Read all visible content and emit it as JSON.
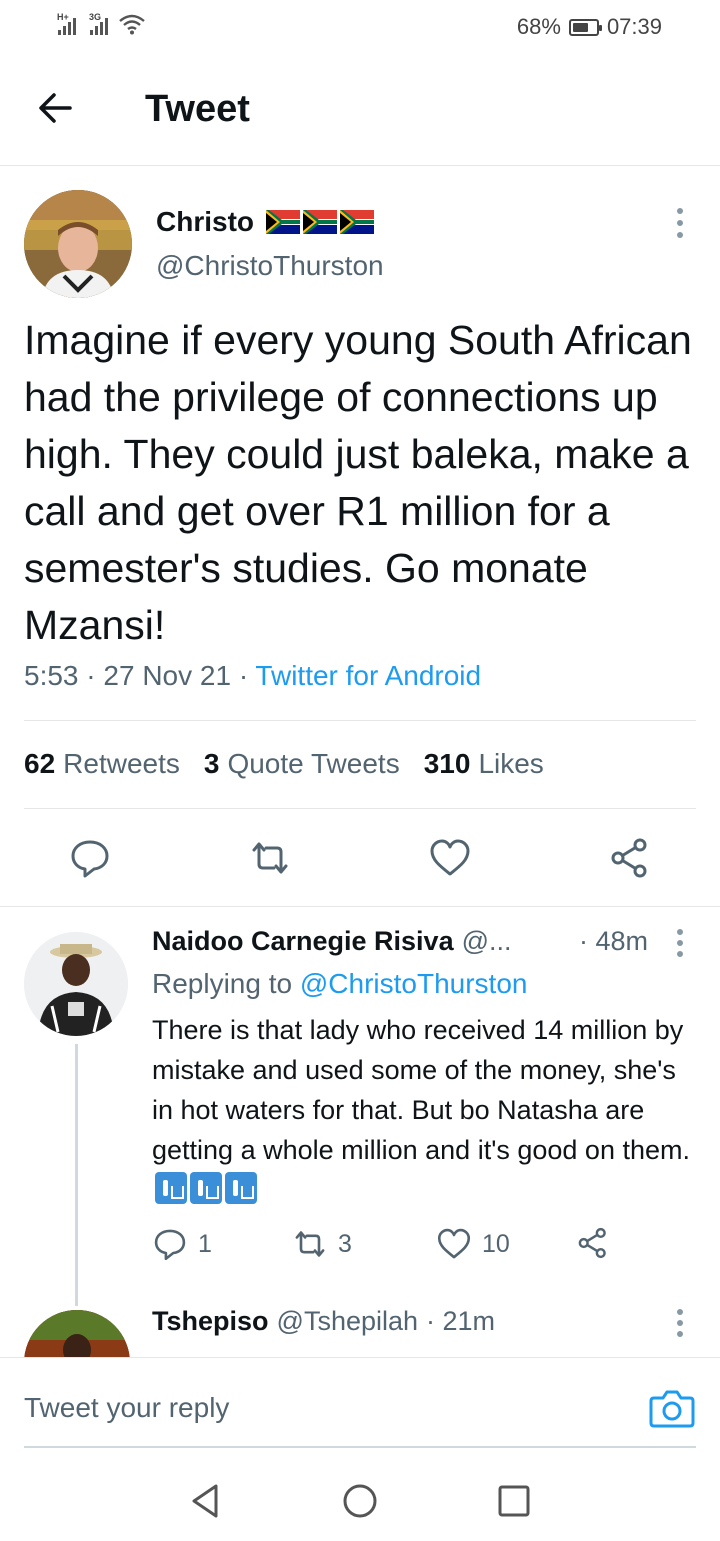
{
  "status_bar": {
    "signal1_tag": "H+",
    "signal2_tag": "3G",
    "battery_percent": "68%",
    "battery_level": 0.68,
    "time": "07:39"
  },
  "header": {
    "title": "Tweet"
  },
  "tweet": {
    "author_name": "Christo",
    "author_handle": "@ChristoThurston",
    "text": "Imagine if every young South African had the privilege of connections up high. They could just baleka, make a call and get over R1 million for a semester's studies. Go monate Mzansi!",
    "time": "5:53",
    "date": "27 Nov 21",
    "source": "Twitter for Android",
    "retweets_count": "62",
    "retweets_label": "Retweets",
    "quote_count": "3",
    "quote_label": "Quote Tweets",
    "likes_count": "310",
    "likes_label": "Likes"
  },
  "replies": [
    {
      "name": "Naidoo Carnegie Risiva",
      "handle": "@...",
      "time": "· 48m",
      "replying_prefix": "Replying to",
      "replying_to": "@ChristoThurston",
      "text": "There is that lady who received 14 million by mistake and used some of the money, she's in hot waters for that. But bo Natasha are getting a whole million and it's good on them.",
      "reply_count": "1",
      "retweet_count": "3",
      "like_count": "10"
    },
    {
      "name": "Tshepiso",
      "handle": "@Tshepilah",
      "time": "· 21m"
    }
  ],
  "reply_bar": {
    "placeholder": "Tweet your reply"
  },
  "colors": {
    "accent": "#1d9bf0",
    "text_primary": "#0f1419",
    "text_secondary": "#536471",
    "divider": "#e6e6e6"
  },
  "icons": {
    "back": "arrow-left-icon",
    "more": "more-vertical-icon",
    "reply": "reply-icon",
    "retweet": "retweet-icon",
    "like": "heart-icon",
    "share": "share-icon",
    "camera": "camera-icon",
    "nav_back": "triangle-back-icon",
    "nav_home": "circle-home-icon",
    "nav_recents": "square-recents-icon",
    "emoji": "put-litter-in-its-place-emoji"
  }
}
